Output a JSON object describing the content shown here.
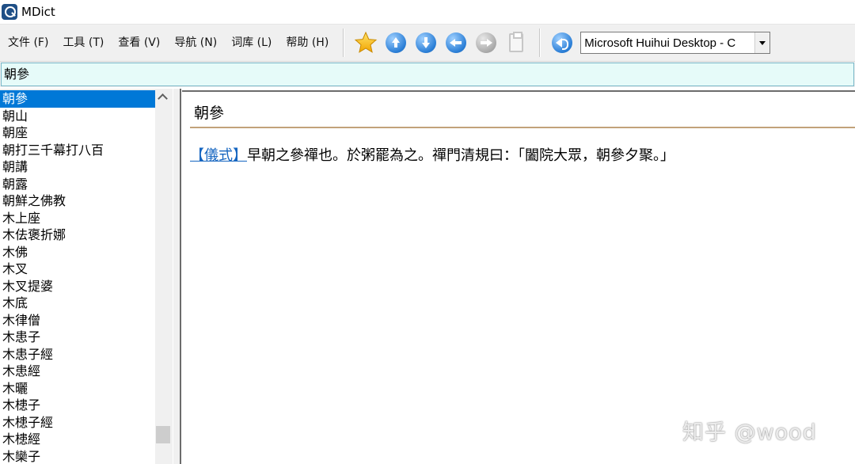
{
  "window": {
    "title": "MDict",
    "icon": "mdict-app-icon"
  },
  "menu": [
    "文件 (F)",
    "工具 (T)",
    "查看 (V)",
    "导航 (N)",
    "词库 (L)",
    "帮助 (H)"
  ],
  "toolbar": {
    "buttons": [
      "favorite-star-icon",
      "previous-entry-icon",
      "next-entry-icon",
      "back-icon",
      "forward-icon",
      "copy-icon",
      "speak-icon"
    ],
    "dictionary_selected": "Microsoft Huihui Desktop - C"
  },
  "search": {
    "value": "朝參"
  },
  "word_list": {
    "selected_index": 0,
    "items": [
      "朝參",
      "朝山",
      "朝座",
      "朝打三千幕打八百",
      "朝講",
      "朝露",
      "朝鮮之佛教",
      "木上座",
      "木佉褒折娜",
      "木佛",
      "木叉",
      "木叉提婆",
      "木底",
      "木律僧",
      "木患子",
      "木患子經",
      "木患經",
      "木曬",
      "木槵子",
      "木槵子經",
      "木槵經",
      "木欒子"
    ]
  },
  "entry": {
    "headword": "朝參",
    "tag": "【儀式】",
    "definition": "早朝之參禪也。於粥罷為之。禪門清規曰：「闔院大眾，朝參夕聚。」"
  },
  "watermark": "知乎 @wood",
  "colors": {
    "selection": "#0078d7",
    "search_bg": "#e6fbf9",
    "link": "#1565c0",
    "rule": "#c2a27a"
  }
}
